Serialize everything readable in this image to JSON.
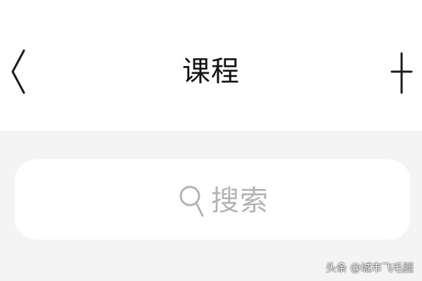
{
  "navbar": {
    "title": "课程",
    "back_icon": "chevron-left-icon",
    "add_icon": "plus-icon"
  },
  "search": {
    "placeholder": "搜索",
    "icon": "search-icon"
  },
  "watermark": {
    "text": "头条 @城市飞毛腿"
  },
  "colors": {
    "background": "#f4f4f5",
    "navbar": "#ffffff",
    "title": "#111111",
    "placeholder": "#b3b3b3",
    "icon": "#1a1a1a"
  }
}
